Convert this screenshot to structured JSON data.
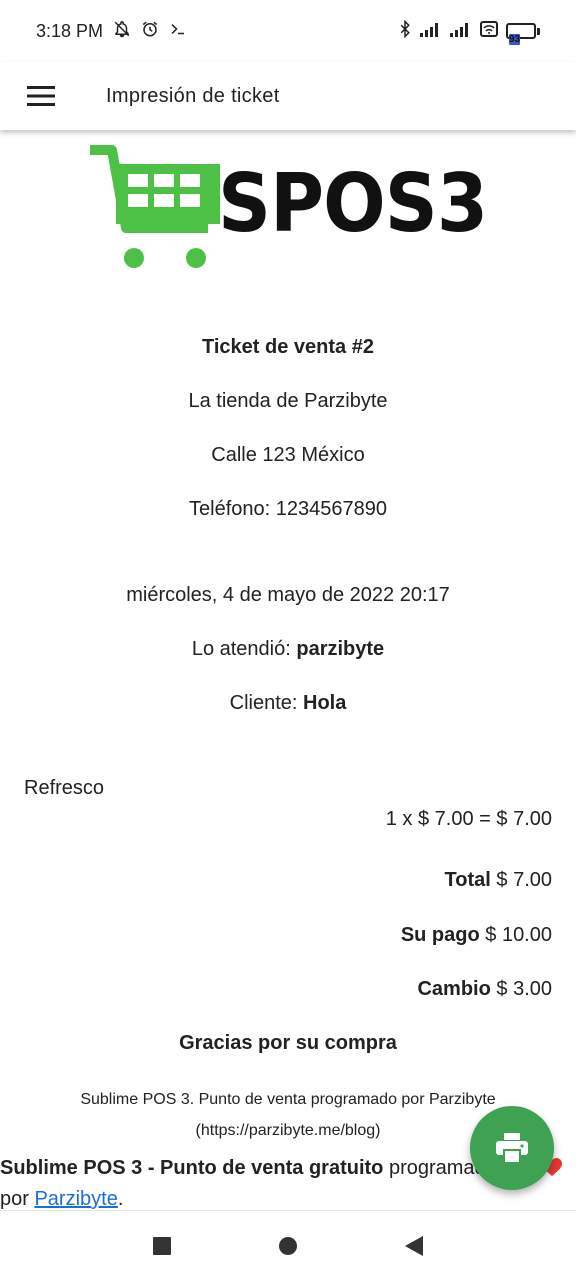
{
  "status_bar": {
    "time": "3:18 PM",
    "battery_level": "93"
  },
  "app_bar": {
    "title": "Impresión de ticket"
  },
  "logo": {
    "text": "SPOS3",
    "cart_color": "#4cc146"
  },
  "ticket": {
    "heading": "Ticket de venta #2",
    "store_name": "La tienda de Parzibyte",
    "address": "Calle 123 México",
    "phone": "Teléfono: 1234567890",
    "date": "miércoles, 4 de mayo de 2022 20:17",
    "attended_label": "Lo atendió: ",
    "attended_value": "parzibyte",
    "client_label": "Cliente: ",
    "client_value": "Hola",
    "items": [
      {
        "name": "Refresco",
        "detail": "1 x $ 7.00 = $ 7.00"
      }
    ],
    "total_label": "Total",
    "total_value": " $ 7.00",
    "payment_label": "Su pago",
    "payment_value": " $ 10.00",
    "change_label": "Cambio",
    "change_value": " $ 3.00",
    "thanks": "Gracias por su compra",
    "footer_small_1": "Sublime POS 3. Punto de venta programado por Parzibyte",
    "footer_small_2": "(https://parzibyte.me/blog)",
    "footer_bold": "Sublime POS 3 - Punto de venta gratuito",
    "footer_rest": " programado con ",
    "footer_by": "por ",
    "footer_link": "Parzibyte",
    "footer_end": "."
  },
  "colors": {
    "fab": "#3fa152",
    "link": "#1a6fd6",
    "heart": "#e53935"
  }
}
